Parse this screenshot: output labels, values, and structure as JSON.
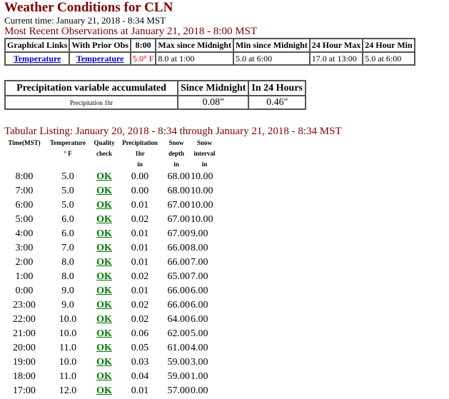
{
  "page": {
    "title": "Weather Conditions for CLN",
    "current_time": "Current time: January 21, 2018 - 8:34 MST",
    "recent_heading": "Most Recent Observations at January 21, 2018 - 8:00 MST"
  },
  "observations": {
    "headers": [
      "Graphical Links",
      "With Prior Obs",
      "8:00",
      "Max since Midnight",
      "Min since Midnight",
      "24 Hour Max",
      "24 Hour Min"
    ],
    "row": {
      "graph_link": "Temperature",
      "prior_link": "Temperature",
      "current": "5.0° F",
      "max_midnight": "8.0 at 1:00",
      "min_midnight": "5.0 at 6:00",
      "max_24": "17.0 at 13:00",
      "min_24": "5.0 at 6:00"
    }
  },
  "precipitation": {
    "headers": [
      "Precipitation variable accumulated",
      "Since Midnight",
      "In 24 Hours"
    ],
    "row": {
      "name": "Precipitation 1hr",
      "since_midnight": "0.08\"",
      "in_24": "0.46\""
    }
  },
  "tabular": {
    "heading": "Tabular Listing: January 20, 2018 - 8:34 through January 21, 2018 - 8:34 MST",
    "header_line1": [
      "Time(MST)",
      "Temperature",
      "Quality",
      "Precipitation",
      "Snow",
      "Snow"
    ],
    "header_line2": [
      "",
      "",
      "check",
      "1hr",
      "depth",
      "interval"
    ],
    "header_line3": [
      "",
      "° F",
      "",
      "in",
      "in",
      "in"
    ],
    "rows": [
      {
        "time": "8:00",
        "temp": "5.0",
        "qc": "OK",
        "precip": "0.00",
        "depth": "68.00",
        "interval": "10.00"
      },
      {
        "time": "7:00",
        "temp": "5.0",
        "qc": "OK",
        "precip": "0.00",
        "depth": "68.00",
        "interval": "10.00"
      },
      {
        "time": "6:00",
        "temp": "5.0",
        "qc": "OK",
        "precip": "0.01",
        "depth": "67.00",
        "interval": "10.00"
      },
      {
        "time": "5:00",
        "temp": "6.0",
        "qc": "OK",
        "precip": "0.02",
        "depth": "67.00",
        "interval": "10.00"
      },
      {
        "time": "4:00",
        "temp": "6.0",
        "qc": "OK",
        "precip": "0.01",
        "depth": "67.00",
        "interval": "9.00"
      },
      {
        "time": "3:00",
        "temp": "7.0",
        "qc": "OK",
        "precip": "0.01",
        "depth": "66.00",
        "interval": "8.00"
      },
      {
        "time": "2:00",
        "temp": "8.0",
        "qc": "OK",
        "precip": "0.01",
        "depth": "66.00",
        "interval": "7.00"
      },
      {
        "time": "1:00",
        "temp": "8.0",
        "qc": "OK",
        "precip": "0.02",
        "depth": "65.00",
        "interval": "7.00"
      },
      {
        "time": "0:00",
        "temp": "9.0",
        "qc": "OK",
        "precip": "0.01",
        "depth": "66.00",
        "interval": "6.00"
      },
      {
        "time": "23:00",
        "temp": "9.0",
        "qc": "OK",
        "precip": "0.02",
        "depth": "66.00",
        "interval": "6.00"
      },
      {
        "time": "22:00",
        "temp": "10.0",
        "qc": "OK",
        "precip": "0.02",
        "depth": "64.00",
        "interval": "6.00"
      },
      {
        "time": "21:00",
        "temp": "10.0",
        "qc": "OK",
        "precip": "0.06",
        "depth": "62.00",
        "interval": "5.00"
      },
      {
        "time": "20:00",
        "temp": "11.0",
        "qc": "OK",
        "precip": "0.05",
        "depth": "61.00",
        "interval": "4.00"
      },
      {
        "time": "19:00",
        "temp": "10.0",
        "qc": "OK",
        "precip": "0.03",
        "depth": "59.00",
        "interval": "3.00"
      },
      {
        "time": "18:00",
        "temp": "11.0",
        "qc": "OK",
        "precip": "0.04",
        "depth": "59.00",
        "interval": "1.00"
      },
      {
        "time": "17:00",
        "temp": "12.0",
        "qc": "OK",
        "precip": "0.01",
        "depth": "57.00",
        "interval": "0.00"
      }
    ]
  },
  "colors": {
    "heading": "#800000",
    "link": "#0000cc",
    "qc_link": "#007700",
    "current_value": "#cc0000"
  }
}
